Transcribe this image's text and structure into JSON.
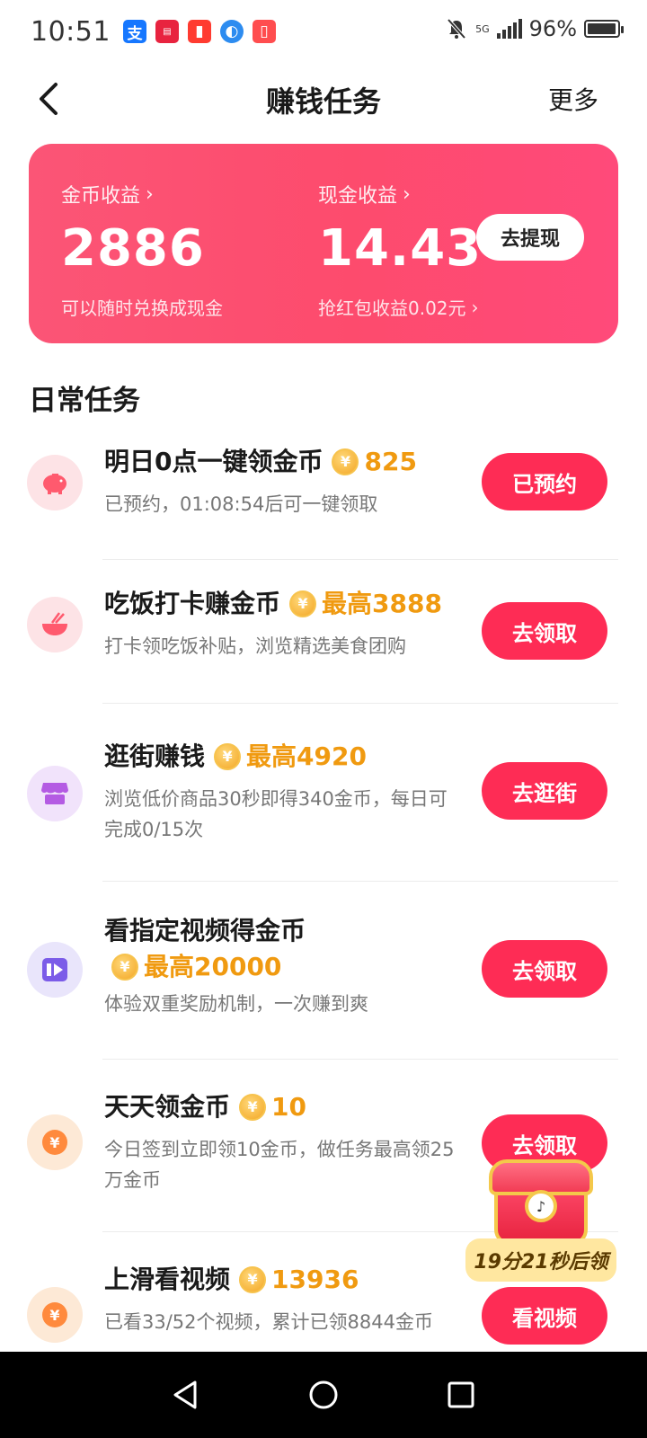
{
  "status_bar": {
    "time": "10:51",
    "network": "5G",
    "battery": "96%",
    "battery_level": 0.96,
    "notification_icons": [
      "alipay-icon",
      "news-icon",
      "redpacket-icon",
      "browser-icon",
      "reader-icon"
    ]
  },
  "header": {
    "title": "赚钱任务",
    "more_label": "更多"
  },
  "earnings": {
    "coin_label": "金币收益",
    "coin_value": "2886",
    "coin_sub": "可以随时兑换成现金",
    "cash_label": "现金收益",
    "cash_value": "14.43",
    "cash_sub": "抢红包收益0.02元",
    "withdraw_label": "去提现"
  },
  "section": {
    "title": "日常任务"
  },
  "tasks": [
    {
      "title": "明日0点一键领金币",
      "reward": "825",
      "desc": "已预约，01:08:54后可一键领取",
      "button": "已预约",
      "icon": "piggy-bank-icon"
    },
    {
      "title": "吃饭打卡赚金币",
      "reward": "最高3888",
      "desc": "打卡领吃饭补贴，浏览精选美食团购",
      "button": "去领取",
      "icon": "rice-bowl-icon"
    },
    {
      "title": "逛街赚钱",
      "reward": "最高4920",
      "desc": "浏览低价商品30秒即得340金币，每日可完成0/15次",
      "button": "去逛街",
      "icon": "shop-icon"
    },
    {
      "title": "看指定视频得金币",
      "reward": "最高20000",
      "desc": "体验双重奖励机制，一次赚到爽",
      "button": "去领取",
      "icon": "video-icon"
    },
    {
      "title": "天天领金币",
      "reward": "10",
      "desc": "今日签到立即领10金币，做任务最高领25万金币",
      "button": "去领取",
      "icon": "yuan-coin-icon"
    },
    {
      "title": "上滑看视频",
      "reward": "13936",
      "desc": "已看33/52个视频，累计已领8844金币",
      "button": "看视频",
      "icon": "yuan-coin-icon"
    }
  ],
  "chest": {
    "timer": "19分21秒后领"
  },
  "colors": {
    "accent": "#fe2c55",
    "reward": "#f09a10",
    "card_gradient_start": "#fb5576",
    "card_gradient_end": "#ff4a7a"
  }
}
